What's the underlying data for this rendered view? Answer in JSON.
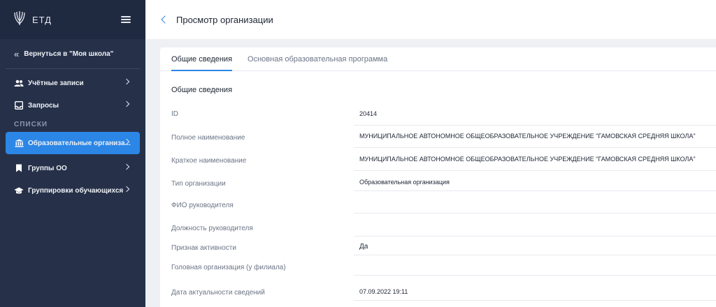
{
  "sidebar": {
    "logo_text": "ЕТД",
    "back_link": "Вернуться в \"Моя школа\"",
    "section_label": "СПИСКИ",
    "items": [
      {
        "label": "Учётные записи"
      },
      {
        "label": "Запросы"
      },
      {
        "label": "Образовательные организа..."
      },
      {
        "label": "Группы ОО"
      },
      {
        "label": "Группировки обучающихся"
      }
    ],
    "active_color": "#2b86e6",
    "background": "#263149"
  },
  "header": {
    "title": "Просмотр организации"
  },
  "tabs": [
    {
      "label": "Общие сведения",
      "active": true
    },
    {
      "label": "Основная образовательная программа",
      "active": false
    }
  ],
  "section_title": "Общие сведения",
  "fields": [
    {
      "label": "ID",
      "value": "20414"
    },
    {
      "label": "Полное наименование",
      "value": "МУНИЦИПАЛЬНОЕ АВТОНОМНОЕ ОБЩЕОБРАЗОВАТЕЛЬНОЕ УЧРЕЖДЕНИЕ \"ГАМОВСКАЯ СРЕДНЯЯ ШКОЛА\""
    },
    {
      "label": "Краткое наименование",
      "value": "МУНИЦИПАЛЬНОЕ АВТОНОМНОЕ ОБЩЕОБРАЗОВАТЕЛЬНОЕ УЧРЕЖДЕНИЕ \"ГАМОВСКАЯ СРЕДНЯЯ ШКОЛА\""
    },
    {
      "label": "Тип организации",
      "value": "Образовательная организация"
    },
    {
      "label": "ФИО руководителя",
      "value": ""
    },
    {
      "label": "Должность руководителя",
      "value": ""
    },
    {
      "label": "Признак активности",
      "value": "Да"
    },
    {
      "label": "Головная организация (у филиала)",
      "value": ""
    },
    {
      "label": "Дата актуальности сведений",
      "value": "07.09.2022 19:11"
    }
  ]
}
